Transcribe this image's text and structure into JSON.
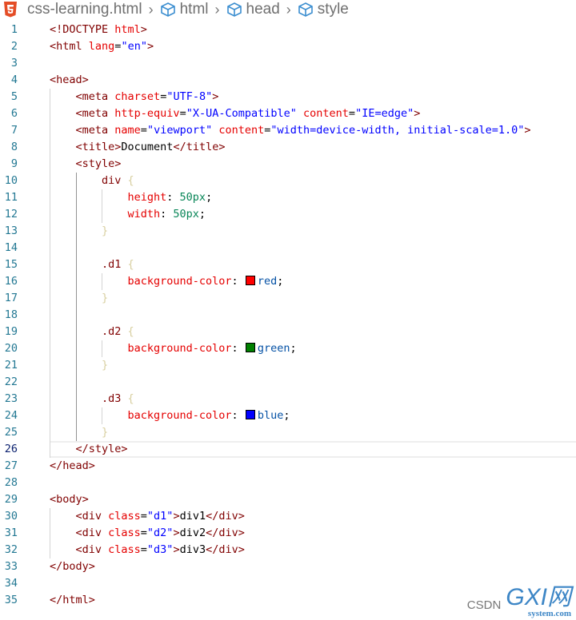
{
  "breadcrumb": {
    "file_icon": "html5-icon",
    "file": "css-learning.html",
    "items": [
      "html",
      "head",
      "style"
    ],
    "item_icon": "cube-icon"
  },
  "editor": {
    "current_line": 26,
    "lines": [
      {
        "n": "1",
        "i": 0,
        "tok": [
          [
            "t",
            "<!DOCTYPE "
          ],
          [
            "a",
            "html"
          ],
          [
            "t",
            ">"
          ]
        ]
      },
      {
        "n": "2",
        "i": 0,
        "tok": [
          [
            "t",
            "<html "
          ],
          [
            "a",
            "lang"
          ],
          [
            "p",
            "="
          ],
          [
            "s",
            "\"en\""
          ],
          [
            "t",
            ">"
          ]
        ]
      },
      {
        "n": "3",
        "i": 0,
        "tok": []
      },
      {
        "n": "4",
        "i": 0,
        "tok": [
          [
            "t",
            "<head>"
          ]
        ]
      },
      {
        "n": "5",
        "i": 1,
        "tok": [
          [
            "t",
            "<meta "
          ],
          [
            "a",
            "charset"
          ],
          [
            "p",
            "="
          ],
          [
            "s",
            "\"UTF-8\""
          ],
          [
            "t",
            ">"
          ]
        ]
      },
      {
        "n": "6",
        "i": 1,
        "tok": [
          [
            "t",
            "<meta "
          ],
          [
            "a",
            "http-equiv"
          ],
          [
            "p",
            "="
          ],
          [
            "s",
            "\"X-UA-Compatible\""
          ],
          [
            "p",
            " "
          ],
          [
            "a",
            "content"
          ],
          [
            "p",
            "="
          ],
          [
            "s",
            "\"IE=edge\""
          ],
          [
            "t",
            ">"
          ]
        ]
      },
      {
        "n": "7",
        "i": 1,
        "tok": [
          [
            "t",
            "<meta "
          ],
          [
            "a",
            "name"
          ],
          [
            "p",
            "="
          ],
          [
            "s",
            "\"viewport\""
          ],
          [
            "p",
            " "
          ],
          [
            "a",
            "content"
          ],
          [
            "p",
            "="
          ],
          [
            "s",
            "\"width=device-width, initial-scale=1.0\""
          ],
          [
            "t",
            ">"
          ]
        ]
      },
      {
        "n": "8",
        "i": 1,
        "tok": [
          [
            "t",
            "<title>"
          ],
          [
            "p",
            "Document"
          ],
          [
            "t",
            "</title>"
          ]
        ]
      },
      {
        "n": "9",
        "i": 1,
        "tok": [
          [
            "t",
            "<style>"
          ]
        ]
      },
      {
        "n": "10",
        "i": 2,
        "tok": [
          [
            "t",
            "div "
          ],
          [
            "b",
            "{"
          ]
        ]
      },
      {
        "n": "11",
        "i": 3,
        "tok": [
          [
            "k",
            "height"
          ],
          [
            "p",
            ": "
          ],
          [
            "n",
            "50px"
          ],
          [
            "p",
            ";"
          ]
        ]
      },
      {
        "n": "12",
        "i": 3,
        "tok": [
          [
            "k",
            "width"
          ],
          [
            "p",
            ": "
          ],
          [
            "n",
            "50px"
          ],
          [
            "p",
            ";"
          ]
        ]
      },
      {
        "n": "13",
        "i": 2,
        "tok": [
          [
            "b",
            "}"
          ]
        ]
      },
      {
        "n": "14",
        "i": 2,
        "tok": []
      },
      {
        "n": "15",
        "i": 2,
        "tok": [
          [
            "t",
            ".d1 "
          ],
          [
            "b",
            "{"
          ]
        ]
      },
      {
        "n": "16",
        "i": 3,
        "tok": [
          [
            "k",
            "background-color"
          ],
          [
            "p",
            ": "
          ],
          [
            "sw",
            "#ff0000"
          ],
          [
            "v",
            "red"
          ],
          [
            "p",
            ";"
          ]
        ]
      },
      {
        "n": "17",
        "i": 2,
        "tok": [
          [
            "b",
            "}"
          ]
        ]
      },
      {
        "n": "18",
        "i": 2,
        "tok": []
      },
      {
        "n": "19",
        "i": 2,
        "tok": [
          [
            "t",
            ".d2 "
          ],
          [
            "b",
            "{"
          ]
        ]
      },
      {
        "n": "20",
        "i": 3,
        "tok": [
          [
            "k",
            "background-color"
          ],
          [
            "p",
            ": "
          ],
          [
            "sw",
            "#008000"
          ],
          [
            "v",
            "green"
          ],
          [
            "p",
            ";"
          ]
        ]
      },
      {
        "n": "21",
        "i": 2,
        "tok": [
          [
            "b",
            "}"
          ]
        ]
      },
      {
        "n": "22",
        "i": 2,
        "tok": []
      },
      {
        "n": "23",
        "i": 2,
        "tok": [
          [
            "t",
            ".d3 "
          ],
          [
            "b",
            "{"
          ]
        ]
      },
      {
        "n": "24",
        "i": 3,
        "tok": [
          [
            "k",
            "background-color"
          ],
          [
            "p",
            ": "
          ],
          [
            "sw",
            "#0000ff"
          ],
          [
            "v",
            "blue"
          ],
          [
            "p",
            ";"
          ]
        ]
      },
      {
        "n": "25",
        "i": 2,
        "tok": [
          [
            "b",
            "}"
          ]
        ]
      },
      {
        "n": "26",
        "i": 1,
        "tok": [
          [
            "t",
            "</style>"
          ]
        ]
      },
      {
        "n": "27",
        "i": 0,
        "tok": [
          [
            "t",
            "</head>"
          ]
        ]
      },
      {
        "n": "28",
        "i": 0,
        "tok": []
      },
      {
        "n": "29",
        "i": 0,
        "tok": [
          [
            "t",
            "<body>"
          ]
        ]
      },
      {
        "n": "30",
        "i": 1,
        "tok": [
          [
            "t",
            "<div "
          ],
          [
            "a",
            "class"
          ],
          [
            "p",
            "="
          ],
          [
            "s",
            "\"d1\""
          ],
          [
            "t",
            ">"
          ],
          [
            "p",
            "div1"
          ],
          [
            "t",
            "</div>"
          ]
        ]
      },
      {
        "n": "31",
        "i": 1,
        "tok": [
          [
            "t",
            "<div "
          ],
          [
            "a",
            "class"
          ],
          [
            "p",
            "="
          ],
          [
            "s",
            "\"d2\""
          ],
          [
            "t",
            ">"
          ],
          [
            "p",
            "div2"
          ],
          [
            "t",
            "</div>"
          ]
        ]
      },
      {
        "n": "32",
        "i": 1,
        "tok": [
          [
            "t",
            "<div "
          ],
          [
            "a",
            "class"
          ],
          [
            "p",
            "="
          ],
          [
            "s",
            "\"d3\""
          ],
          [
            "t",
            ">"
          ],
          [
            "p",
            "div3"
          ],
          [
            "t",
            "</div>"
          ]
        ]
      },
      {
        "n": "33",
        "i": 0,
        "tok": [
          [
            "t",
            "</body>"
          ]
        ]
      },
      {
        "n": "34",
        "i": 0,
        "tok": []
      },
      {
        "n": "35",
        "i": 0,
        "tok": [
          [
            "t",
            "</html>"
          ]
        ]
      }
    ]
  },
  "watermark": {
    "csdn": "CSDN",
    "brand": "GXI网",
    "domain": "system.com"
  }
}
